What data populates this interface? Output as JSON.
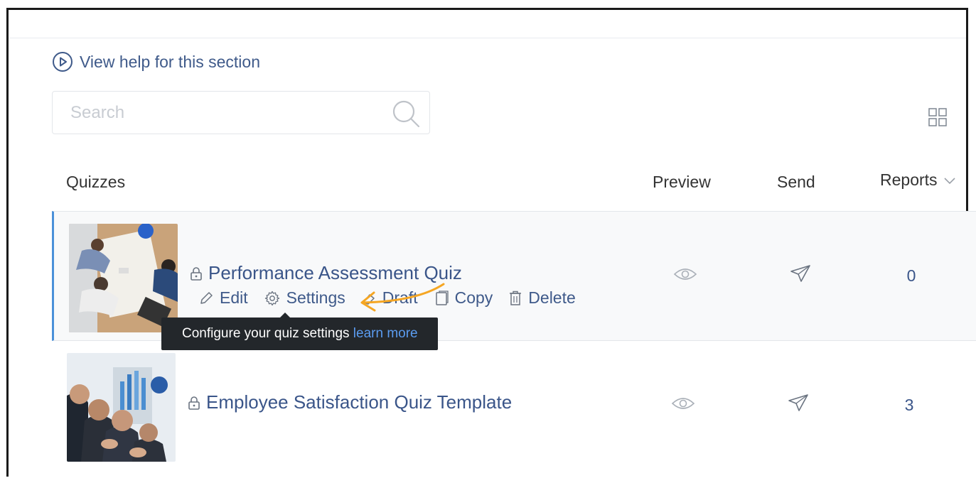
{
  "help": {
    "label": "View help for this section"
  },
  "search": {
    "placeholder": "Search"
  },
  "table": {
    "headers": {
      "quizzes": "Quizzes",
      "preview": "Preview",
      "send": "Send",
      "reports": "Reports"
    }
  },
  "rows": [
    {
      "title": "Performance Assessment Quiz",
      "reports": "0",
      "actions": {
        "edit": "Edit",
        "settings": "Settings",
        "draft": "Draft",
        "copy": "Copy",
        "delete": "Delete"
      }
    },
    {
      "title": "Employee Satisfaction Quiz Template",
      "reports": "3"
    }
  ],
  "tooltip": {
    "text": "Configure your quiz settings ",
    "link": "learn more"
  },
  "colors": {
    "link": "#3a5589",
    "accent_bar": "#4a90d9",
    "annotation_arrow": "#f5a623",
    "tooltip_bg": "#23272b"
  }
}
